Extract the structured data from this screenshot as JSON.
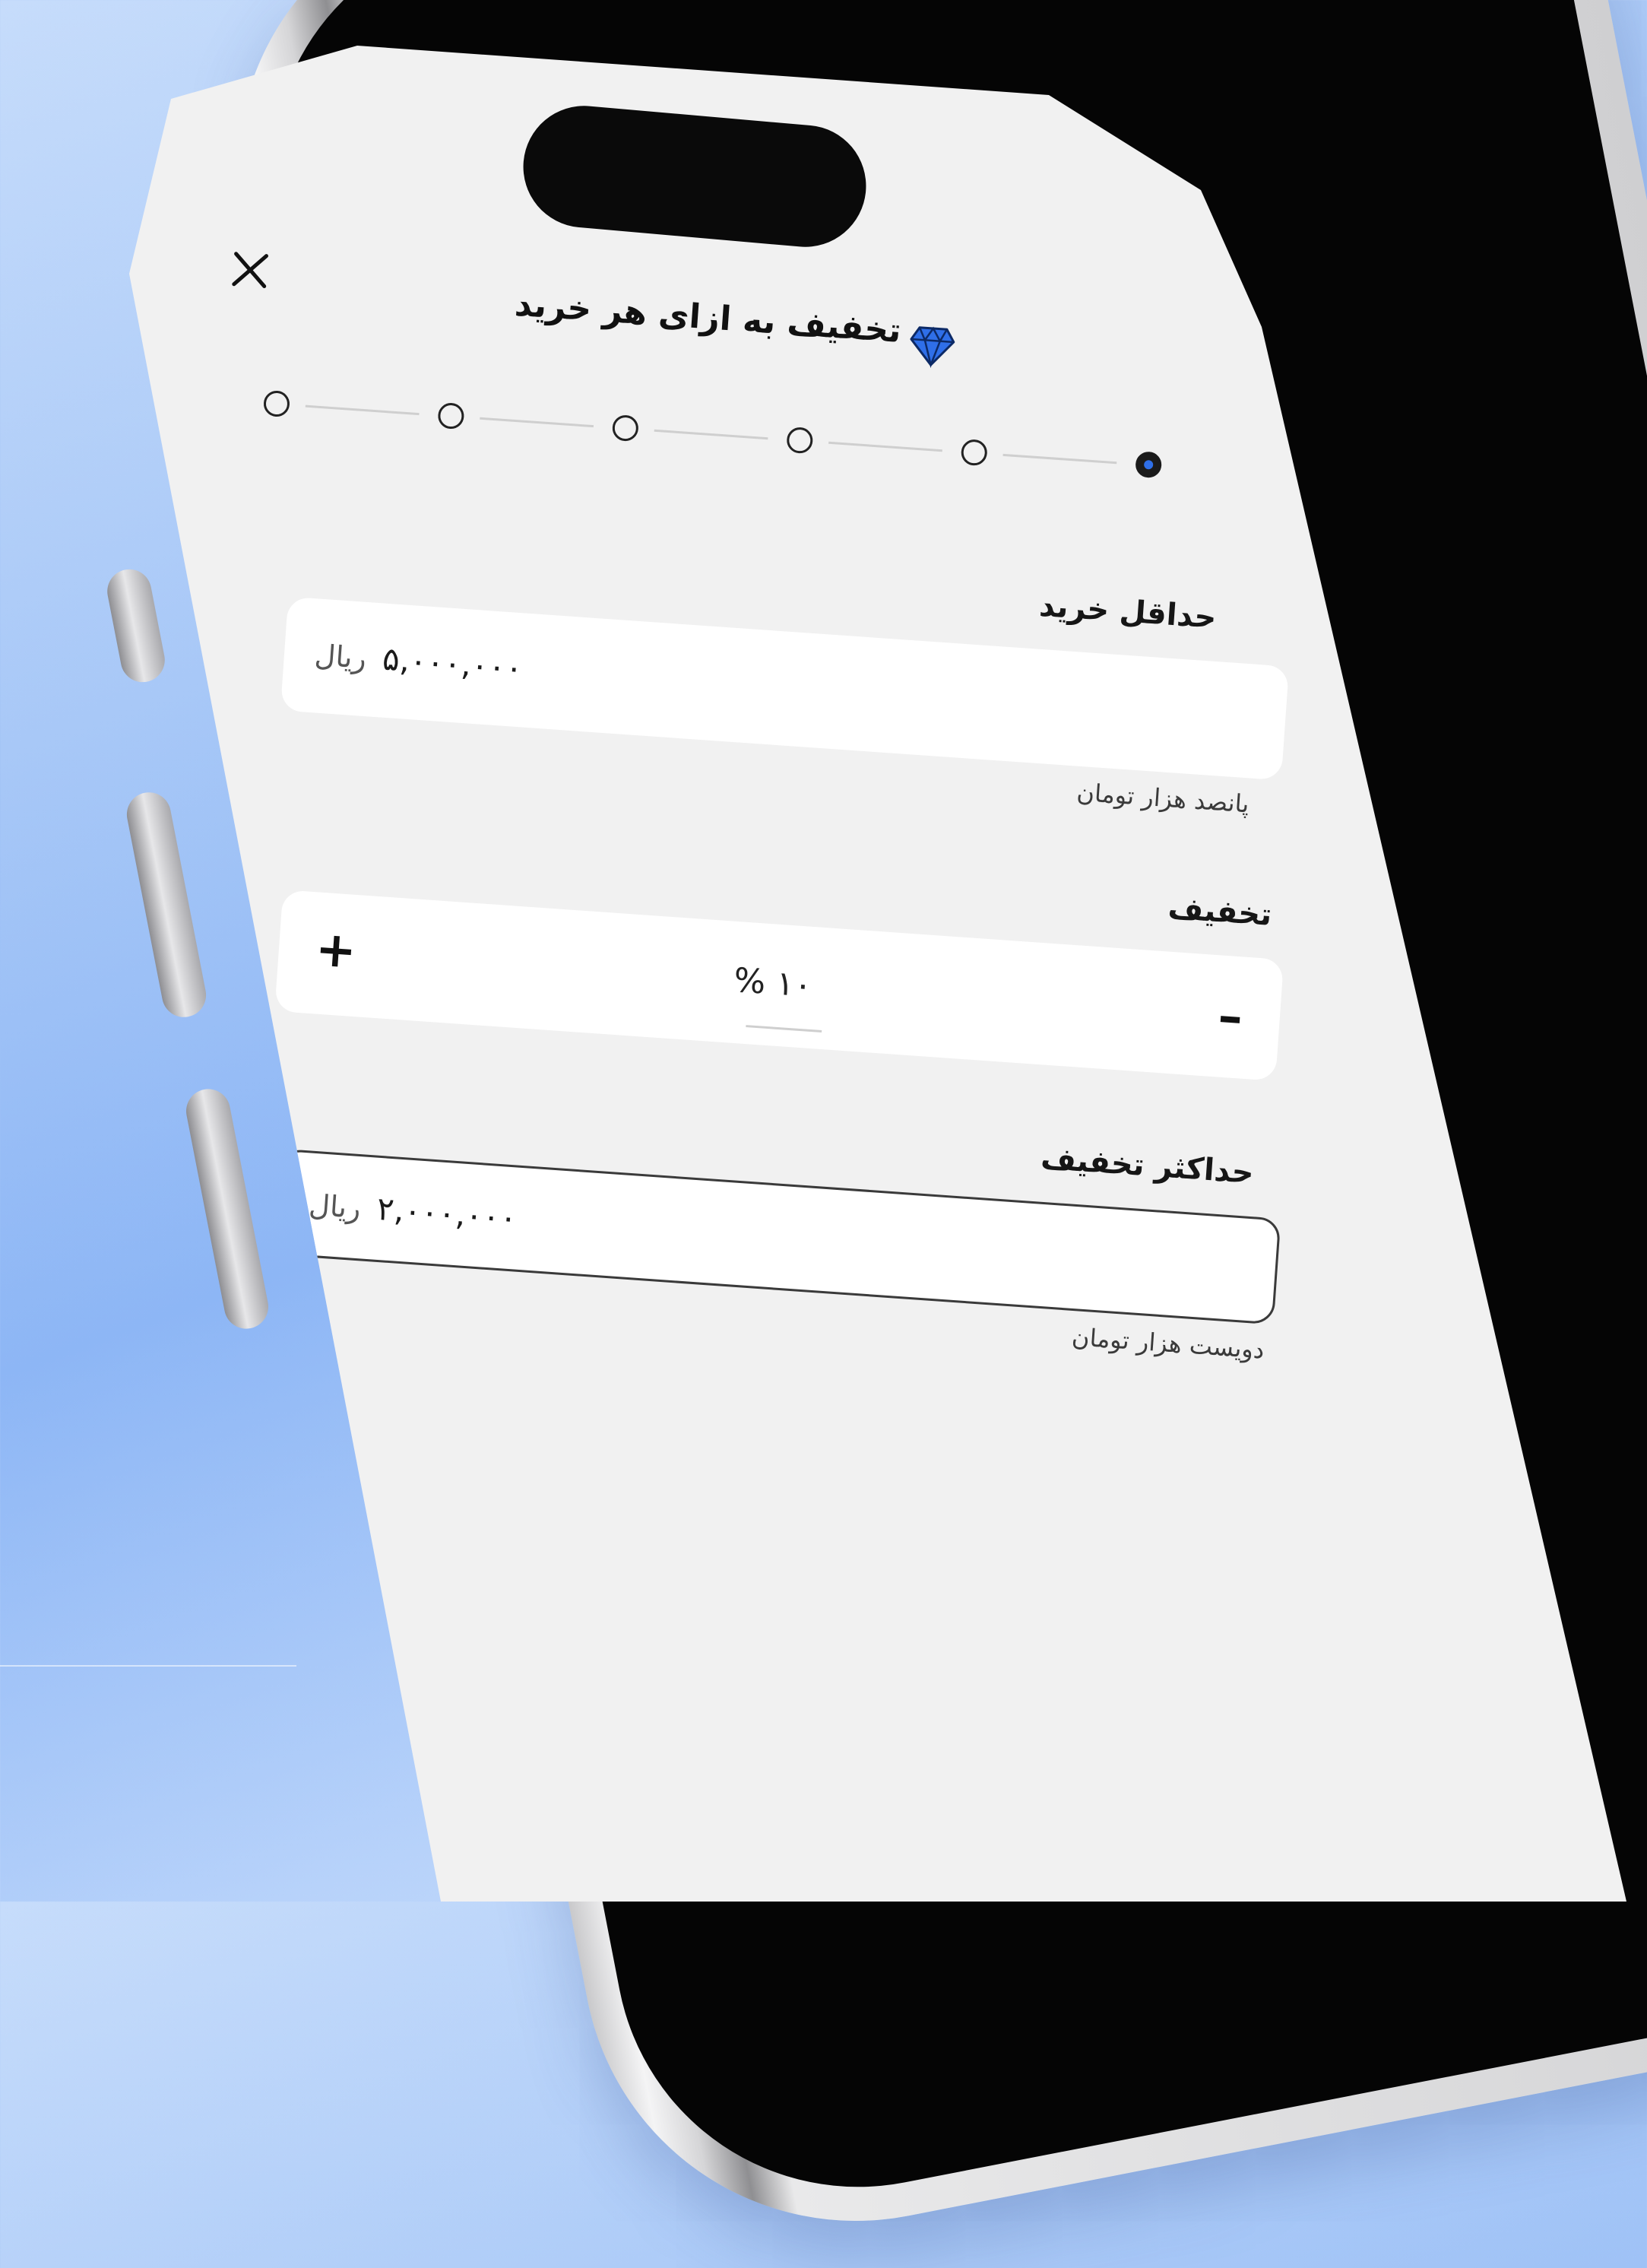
{
  "header": {
    "title": "تخفیف به ازای هر خرید"
  },
  "steps": {
    "count": 6,
    "active_index": 5
  },
  "min_purchase": {
    "label": "حداقل خرید",
    "amount": "۵,۰۰۰,۰۰۰",
    "currency": "ریال",
    "hint": "پانصد هزار تومان"
  },
  "discount": {
    "label": "تخفیف",
    "value": "۱۰",
    "unit": "%",
    "plus": "+",
    "minus": "–"
  },
  "max_discount": {
    "label": "حداکثر تخفیف",
    "amount": "۲,۰۰۰,۰۰۰",
    "currency": "ریال",
    "hint": "دویست هزار تومان"
  },
  "colors": {
    "accent": "#2f6fe8",
    "screen_bg": "#f1f1f1"
  }
}
